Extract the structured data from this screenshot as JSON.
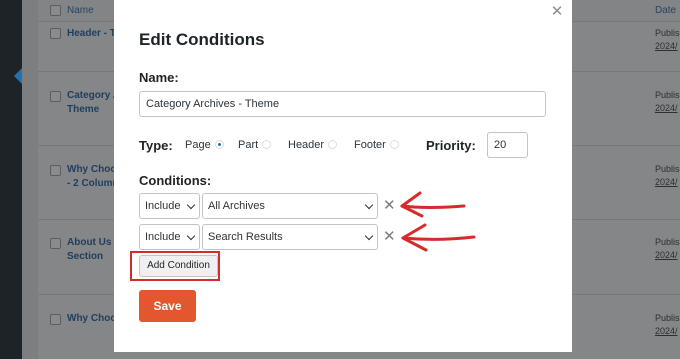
{
  "background": {
    "table_header": {
      "name_col": "Name",
      "date_col": "Date"
    },
    "rows": [
      {
        "title_line1": "Header - T",
        "title_line2": "",
        "date_status": "Publis",
        "date_value": "2024/"
      },
      {
        "title_line1": "Category A",
        "title_line2": "Theme",
        "date_status": "Publis",
        "date_value": "2024/"
      },
      {
        "title_line1": "Why Choo",
        "title_line2": "- 2 Column",
        "date_status": "Publis",
        "date_value": "2024/"
      },
      {
        "title_line1": "About Us C",
        "title_line2": "Section",
        "date_status": "Publis",
        "date_value": "2024/"
      },
      {
        "title_line1": "Why Choo",
        "title_line2": "",
        "date_status": "Publis",
        "date_value": "2024/"
      }
    ]
  },
  "modal": {
    "title": "Edit Conditions",
    "close_icon": "close-icon",
    "name_label": "Name:",
    "name_value": "Category Archives - Theme",
    "type_label": "Type:",
    "type_options": [
      {
        "label": "Page",
        "selected": true
      },
      {
        "label": "Part",
        "selected": false
      },
      {
        "label": "Header",
        "selected": false
      },
      {
        "label": "Footer",
        "selected": false
      }
    ],
    "priority_label": "Priority:",
    "priority_value": "20",
    "conditions_label": "Conditions:",
    "conditions": [
      {
        "mode": "Include",
        "target": "All Archives"
      },
      {
        "mode": "Include",
        "target": "Search Results"
      }
    ],
    "add_condition_label": "Add Condition",
    "save_label": "Save"
  },
  "colors": {
    "accent_save": "#e3572f",
    "annotation_red": "#d62b2b",
    "radio_selected": "#2271b1"
  }
}
